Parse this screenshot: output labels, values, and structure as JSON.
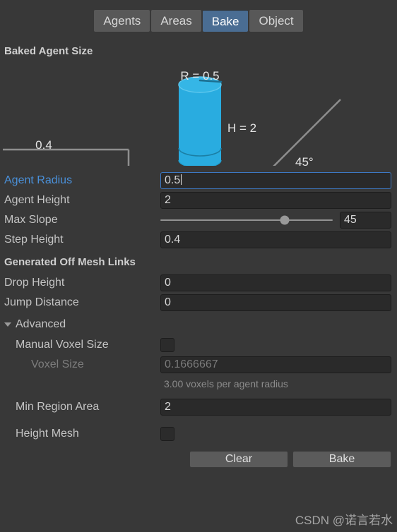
{
  "tabs": [
    {
      "label": "Agents",
      "selected": false
    },
    {
      "label": "Areas",
      "selected": false
    },
    {
      "label": "Bake",
      "selected": true
    },
    {
      "label": "Object",
      "selected": false
    }
  ],
  "sections": {
    "baked_agent_size": "Baked Agent Size",
    "generated_off_mesh_links": "Generated Off Mesh Links",
    "advanced": "Advanced"
  },
  "diagram": {
    "radius_label": "R = 0.5",
    "height_label": "H = 2",
    "step_label": "0.4",
    "slope_label": "45°",
    "cylinder_color": "#29ace0",
    "cylinder_shade": "#1f9ccc",
    "line_color": "#8e8e8e"
  },
  "fields": {
    "agent_radius": {
      "label": "Agent Radius",
      "value": "0.5"
    },
    "agent_height": {
      "label": "Agent Height",
      "value": "2"
    },
    "max_slope": {
      "label": "Max Slope",
      "value": "45",
      "percent": 72
    },
    "step_height": {
      "label": "Step Height",
      "value": "0.4"
    },
    "drop_height": {
      "label": "Drop Height",
      "value": "0"
    },
    "jump_distance": {
      "label": "Jump Distance",
      "value": "0"
    },
    "manual_voxel_size": {
      "label": "Manual Voxel Size",
      "checked": false
    },
    "voxel_size": {
      "label": "Voxel Size",
      "value": "0.1666667"
    },
    "voxel_helper": "3.00 voxels per agent radius",
    "min_region_area": {
      "label": "Min Region Area",
      "value": "2"
    },
    "height_mesh": {
      "label": "Height Mesh",
      "checked": false
    }
  },
  "buttons": {
    "clear": "Clear",
    "bake": "Bake"
  },
  "watermark": "CSDN @诺言若水",
  "colors": {
    "background": "#383838",
    "accent_blue": "#4a90d9",
    "tab_selected": "#4a6d93"
  }
}
